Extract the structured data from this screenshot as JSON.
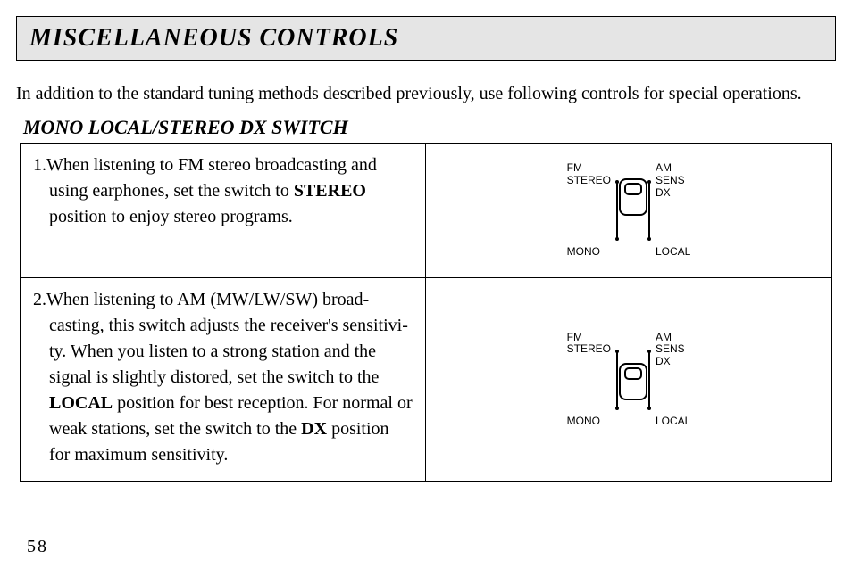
{
  "title": "MISCELLANEOUS CONTROLS",
  "intro": "In addition to the standard tuning methods described previously, use following controls for special operations.",
  "subhead": "MONO LOCAL/STEREO DX SWITCH",
  "step1_num": "1.",
  "step1_a": "When listening to FM stereo broadcasting and using earphones, set the switch to ",
  "step1_bold": "STEREO",
  "step1_b": " position to enjoy stereo programs.",
  "step2_num": "2.",
  "step2_a": "When listening to AM (MW/LW/SW) broad-casting, this switch adjusts the receiver's sensitivi-ty. When you listen to a strong station and the signal is slightly distored, set the switch to the ",
  "step2_bold1": "LOCAL",
  "step2_b": " position for best reception. For normal or weak stations, set the switch to the ",
  "step2_bold2": "DX",
  "step2_c": " position for maximum sensitivity.",
  "fig": {
    "left_top": "FM\nSTEREO",
    "left_bot": "MONO",
    "right_top": "AM\nSENS\nDX",
    "right_bot": "LOCAL"
  },
  "page_number": "58"
}
